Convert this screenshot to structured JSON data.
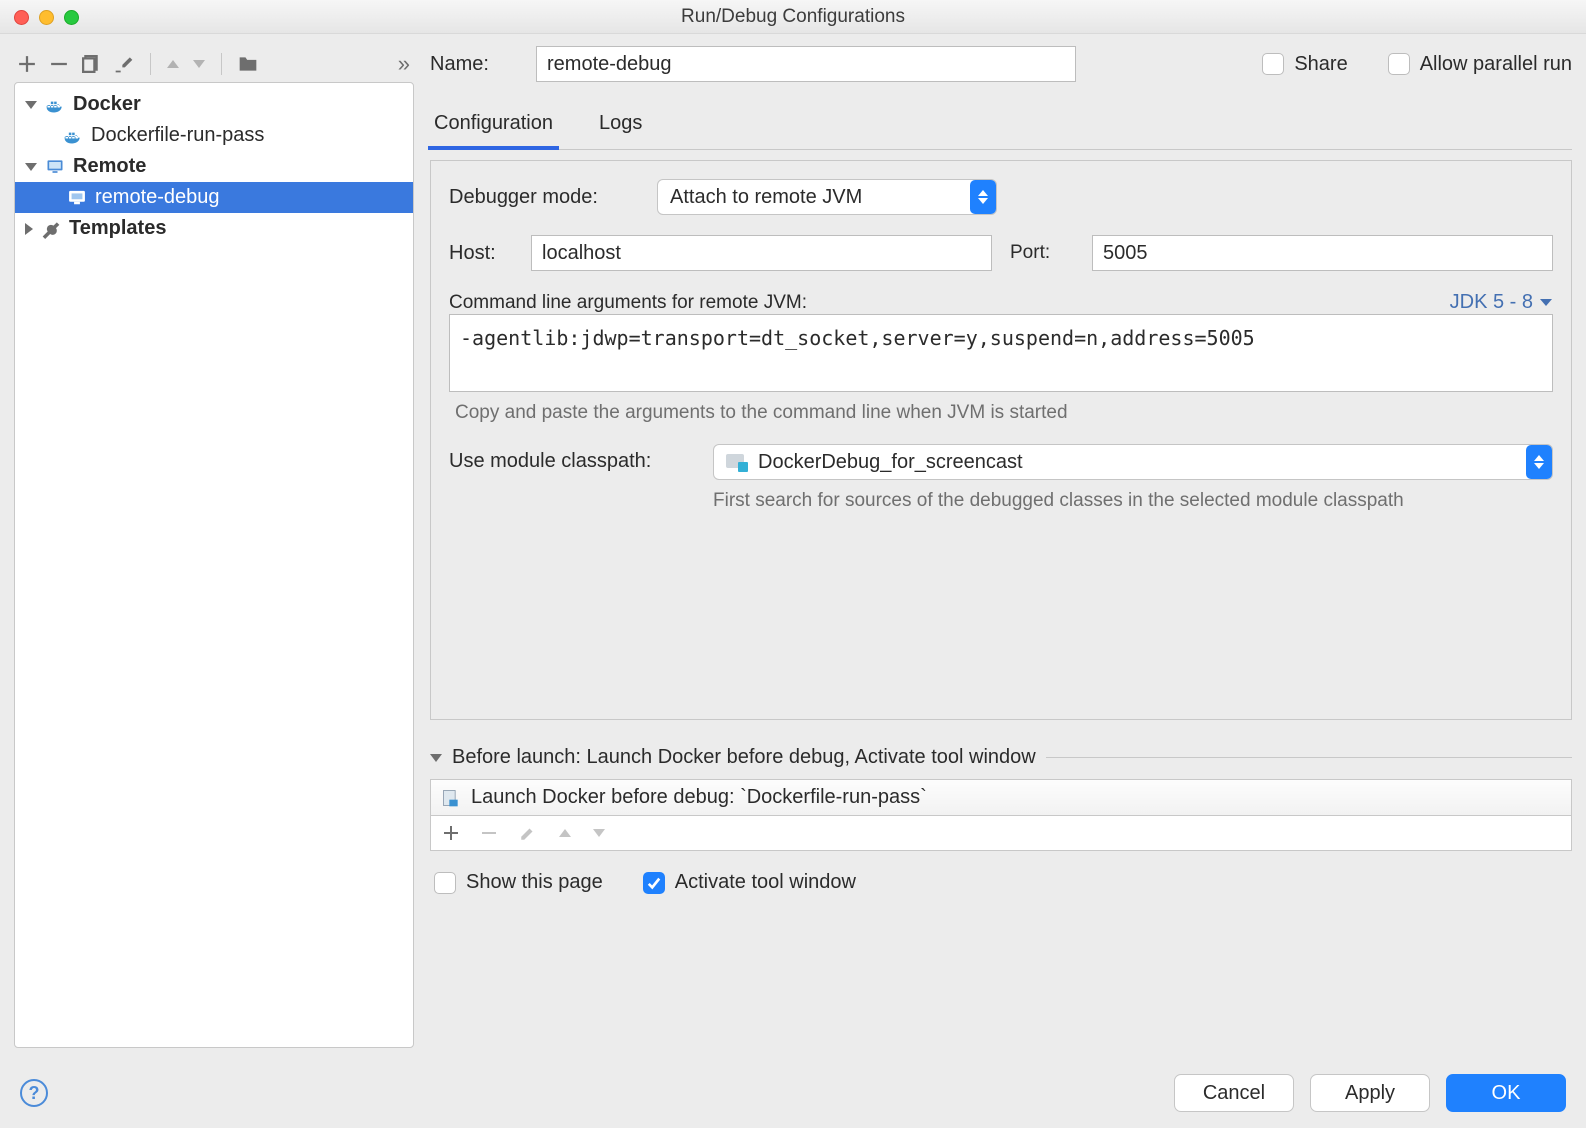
{
  "window": {
    "title": "Run/Debug Configurations"
  },
  "sidebar_tree": {
    "docker": {
      "label": "Docker",
      "child": "Dockerfile-run-pass"
    },
    "remote": {
      "label": "Remote",
      "child": "remote-debug"
    },
    "templates": {
      "label": "Templates"
    }
  },
  "header": {
    "name_label": "Name:",
    "name_value": "remote-debug",
    "share_label": "Share",
    "allow_parallel_label": "Allow parallel run"
  },
  "tabs": {
    "configuration": "Configuration",
    "logs": "Logs"
  },
  "config": {
    "debugger_mode_label": "Debugger mode:",
    "debugger_mode_value": "Attach to remote JVM",
    "host_label": "Host:",
    "host_value": "localhost",
    "port_label": "Port:",
    "port_value": "5005",
    "cmdline_label": "Command line arguments for remote JVM:",
    "jdk_label": "JDK 5 - 8",
    "cmdline_value": "-agentlib:jdwp=transport=dt_socket,server=y,suspend=n,address=5005",
    "cmdline_hint": "Copy and paste the arguments to the command line when JVM is started",
    "classpath_label": "Use module classpath:",
    "classpath_value": "DockerDebug_for_screencast",
    "classpath_hint": "First search for sources of the debugged classes in the selected module classpath"
  },
  "before_launch": {
    "section_title": "Before launch: Launch Docker before debug, Activate tool window",
    "item_text": "Launch Docker before debug: `Dockerfile-run-pass`",
    "show_page_label": "Show this page",
    "activate_tool_label": "Activate tool window"
  },
  "footer": {
    "cancel": "Cancel",
    "apply": "Apply",
    "ok": "OK"
  }
}
